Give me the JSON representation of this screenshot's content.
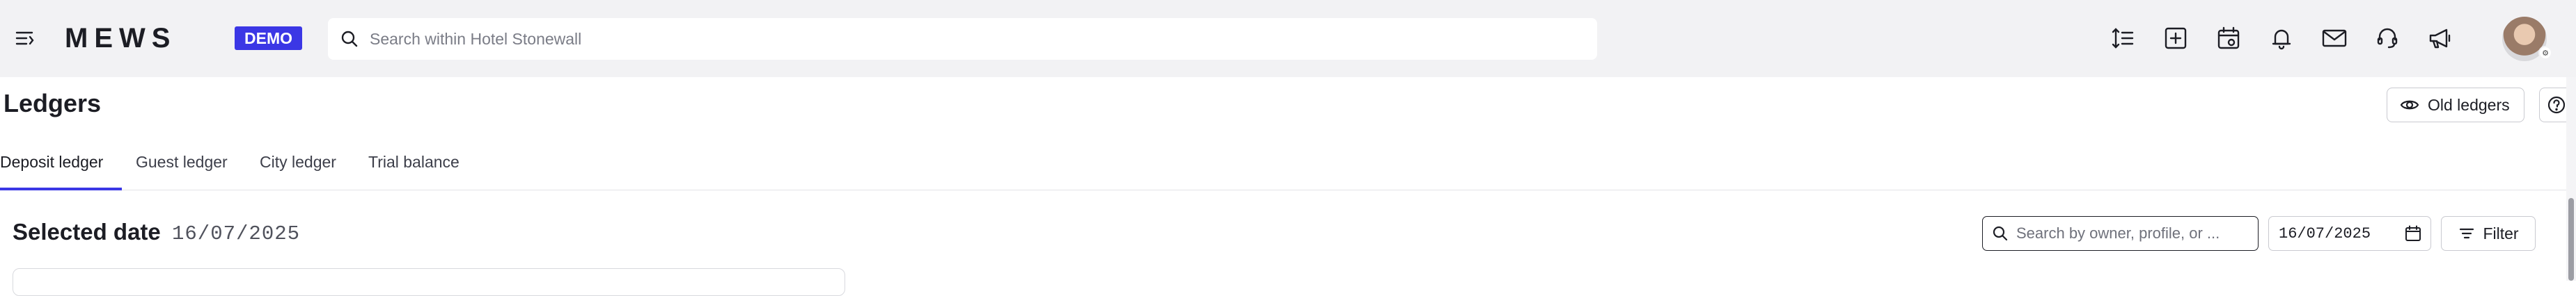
{
  "brand": {
    "logo_text": "MEWS",
    "badge": "DEMO",
    "accent": "#3b37e5"
  },
  "search": {
    "placeholder": "Search within Hotel Stonewall"
  },
  "toolbar_icons": [
    "sort-lines-icon",
    "add-square-icon",
    "calendar-icon",
    "bell-icon",
    "mail-icon",
    "support-icon",
    "megaphone-icon"
  ],
  "page": {
    "title": "Ledgers",
    "old_ledgers_label": "Old ledgers",
    "help_icon": "question-icon"
  },
  "tabs": [
    {
      "label": "Deposit ledger",
      "active": true
    },
    {
      "label": "Guest ledger",
      "active": false
    },
    {
      "label": "City ledger",
      "active": false
    },
    {
      "label": "Trial balance",
      "active": false
    }
  ],
  "filters": {
    "selected_date_label": "Selected date",
    "selected_date_value": "16/07/2025",
    "owner_search_placeholder": "Search by owner, profile, or ...",
    "date_value": "16/07/2025",
    "filter_label": "Filter"
  }
}
